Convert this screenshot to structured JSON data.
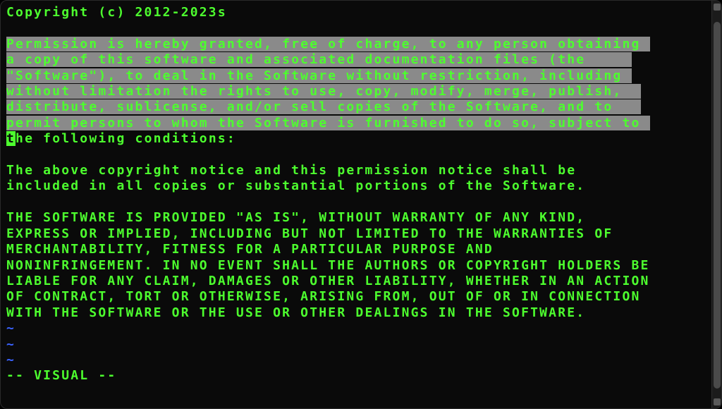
{
  "editor": {
    "mode_line": "-- VISUAL --",
    "pre_selection": "Copyright (c) 2012-2023s\n\n",
    "selection": "Permission is hereby granted, free of charge, to any person obtaining \na copy of this software and associated documentation files (the     \n\"Software\"), to deal in the Software without restriction, including \nwithout limitation the rights to use, copy, modify, merge, publish,  \ndistribute, sublicense, and/or sell copies of the Software, and to   \npermit persons to whom the Software is furnished to do so, subject to \n",
    "cursor_char": "t",
    "post_selection_same_line": "he following conditions:",
    "post_selection": "\n\nThe above copyright notice and this permission notice shall be\nincluded in all copies or substantial portions of the Software.\n\nTHE SOFTWARE IS PROVIDED \"AS IS\", WITHOUT WARRANTY OF ANY KIND,\nEXPRESS OR IMPLIED, INCLUDING BUT NOT LIMITED TO THE WARRANTIES OF\nMERCHANTABILITY, FITNESS FOR A PARTICULAR PURPOSE AND\nNONINFRINGEMENT. IN NO EVENT SHALL THE AUTHORS OR COPYRIGHT HOLDERS BE\nLIABLE FOR ANY CLAIM, DAMAGES OR OTHER LIABILITY, WHETHER IN AN ACTION\nOF CONTRACT, TORT OR OTHERWISE, ARISING FROM, OUT OF OR IN CONNECTION\nWITH THE SOFTWARE OR THE USE OR OTHER DEALINGS IN THE SOFTWARE.",
    "tilde": "~"
  }
}
